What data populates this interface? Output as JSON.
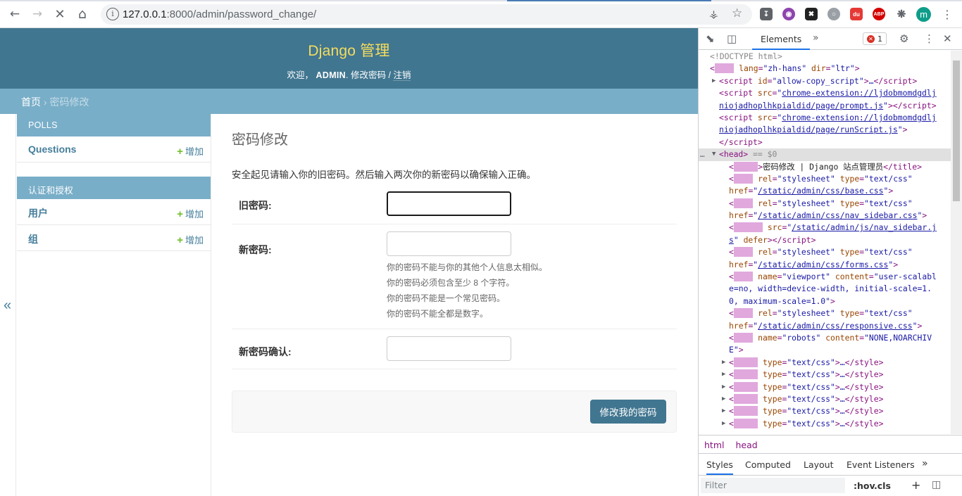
{
  "browser": {
    "url_host": "127.0.0.1",
    "url_rest": ":8000/admin/password_change/",
    "avatar_letter": "m",
    "abp_label": "ABP"
  },
  "admin": {
    "branding": "Django 管理",
    "welcome": "欢迎，",
    "username": "ADMIN",
    "change_password_link": "修改密码",
    "sep": "/",
    "logout_link": "注销",
    "breadcrumb_home": "首页",
    "breadcrumb_sep": "›",
    "breadcrumb_current": "密码修改",
    "nav_toggle": "«"
  },
  "sidebar": {
    "modules": [
      {
        "title": "POLLS",
        "rows": [
          {
            "name": "Questions",
            "add": "增加"
          }
        ]
      },
      {
        "title": "认证和授权",
        "rows": [
          {
            "name": "用户",
            "add": "增加"
          },
          {
            "name": "组",
            "add": "增加"
          }
        ]
      }
    ]
  },
  "form": {
    "title": "密码修改",
    "intro": "安全起见请输入你的旧密码。然后输入两次你的新密码以确保输入正确。",
    "old_password_label": "旧密码:",
    "new_password_label": "新密码:",
    "confirm_label": "新密码确认:",
    "help": [
      "你的密码不能与你的其他个人信息太相似。",
      "你的密码必须包含至少 8 个字符。",
      "你的密码不能是一个常见密码。",
      "你的密码不能全都是数字。"
    ],
    "submit": "修改我的密码"
  },
  "devtools": {
    "tab_elements": "Elements",
    "error_count": "1",
    "breadcrumb": [
      "html",
      "head"
    ],
    "styles_tabs": [
      "Styles",
      "Computed",
      "Layout",
      "Event Listeners"
    ],
    "filter_placeholder": "Filter",
    "hov": ":hov",
    "cls": ".cls"
  },
  "colors": {
    "header_bg": "#417690",
    "branding": "#f5dd5d",
    "breadcrumb_bg": "#79aec8",
    "link": "#447e9b",
    "add_plus": "#70bf2b"
  }
}
